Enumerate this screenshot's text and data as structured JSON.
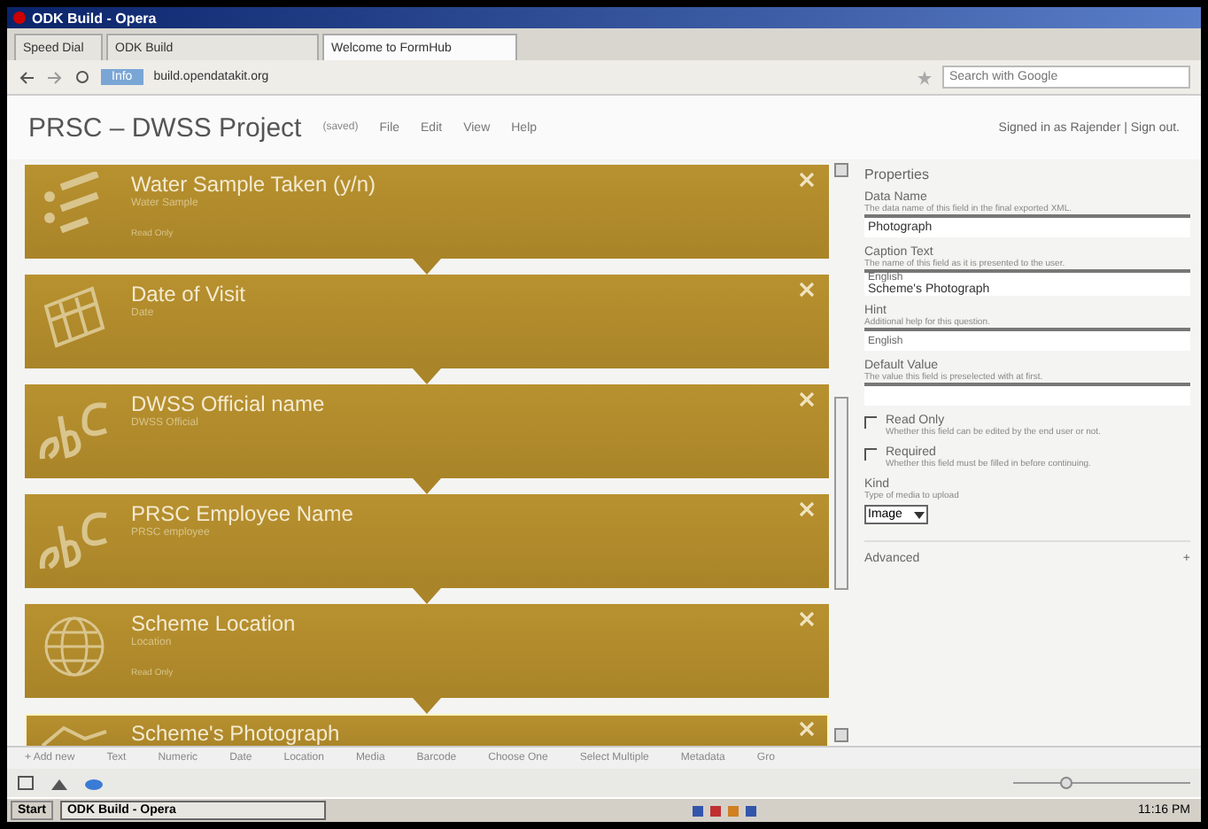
{
  "window": {
    "title": "ODK Build - Opera"
  },
  "tabs": [
    {
      "label": "Speed Dial",
      "selected": false
    },
    {
      "label": "ODK Build",
      "selected": false
    },
    {
      "label": "Welcome to FormHub",
      "selected": true
    }
  ],
  "address_bar": {
    "badge": "Info",
    "url": "build.opendatakit.org",
    "search_placeholder": "Search with Google"
  },
  "app_header": {
    "title": "PRSC – DWSS Project",
    "status": "(saved)",
    "menu": [
      "File",
      "Edit",
      "View",
      "Help"
    ],
    "account": "Signed in as Rajender | Sign out."
  },
  "fields": [
    {
      "kind": "select",
      "title": "Water Sample Taken (y/n)",
      "name": "Water Sample",
      "note": "Read Only",
      "selected": false
    },
    {
      "kind": "date",
      "title": "Date of Visit",
      "name": "Date",
      "selected": false
    },
    {
      "kind": "text",
      "title": "DWSS Official name",
      "name": "DWSS Official",
      "selected": false
    },
    {
      "kind": "text",
      "title": "PRSC Employee Name",
      "name": "PRSC employee",
      "selected": false
    },
    {
      "kind": "location",
      "title": "Scheme Location",
      "name": "Location",
      "note": "Read Only",
      "selected": false
    },
    {
      "kind": "media",
      "title": "Scheme's Photograph",
      "selected": true
    }
  ],
  "properties": {
    "title": "Properties",
    "items": [
      {
        "kind": "input",
        "label": "Data Name",
        "hint": "The data name of this field in the final exported XML.",
        "value": "Photograph"
      },
      {
        "kind": "input",
        "label": "Caption Text",
        "hint": "The name of this field as it is presented to the user.",
        "language": "English",
        "value": "Scheme's Photograph"
      },
      {
        "kind": "input",
        "label": "Hint",
        "hint": "Additional help for this question.",
        "language": "English"
      },
      {
        "kind": "input",
        "label": "Default Value",
        "hint": "The value this field is preselected with at first."
      },
      {
        "kind": "checkbox",
        "label": "Read Only",
        "hint": "Whether this field can be edited by the end user or not.",
        "checked": false
      },
      {
        "kind": "checkbox",
        "label": "Required",
        "hint": "Whether this field must be filled in before continuing.",
        "checked": false
      },
      {
        "kind": "select",
        "label": "Kind",
        "hint": "Type of media to upload",
        "value": "Image"
      }
    ],
    "advanced": "Advanced",
    "advanced_toggle": "+"
  },
  "toolbar": [
    "+ Add new",
    "Text",
    "Numeric",
    "Date",
    "Location",
    "Media",
    "Barcode",
    "Choose One",
    "Select Multiple",
    "Metadata",
    "Gro"
  ],
  "taskbar": {
    "start": "Start",
    "task": "ODK Build - Opera",
    "clock": "11:16 PM"
  }
}
